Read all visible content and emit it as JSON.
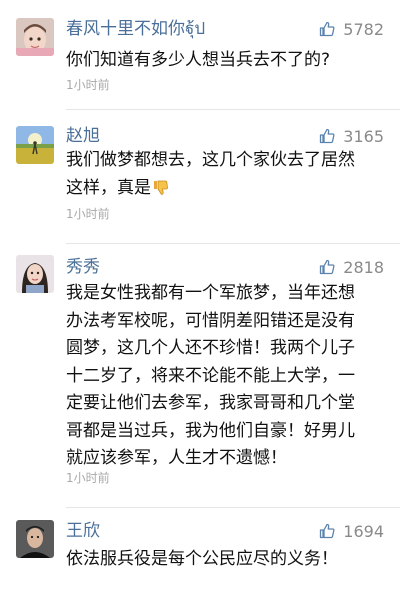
{
  "comments": [
    {
      "user": "春风十里不如你ฐุ้ป",
      "likes": "5782",
      "text_lines": [
        "你们知道有多少人想当兵去不了的?"
      ],
      "time": "1小时前"
    },
    {
      "user": "赵旭",
      "likes": "3165",
      "text_lines": [
        "我们做梦都想去，这几个家伙去了居然",
        "这样，真是"
      ],
      "emoji": "thumbs-down-emoji",
      "time": "1小时前"
    },
    {
      "user": "秀秀",
      "likes": "2818",
      "text_lines": [
        "我是女性我都有一个军旅梦，当年还想",
        "办法考军校呢，可惜阴差阳错还是没有",
        "圆梦，这几个人还不珍惜！我两个儿子",
        "十二岁了，将来不论能不能上大学，一",
        "定要让他们去参军，我家哥哥和几个堂",
        "哥都是当过兵，我为他们自豪！好男儿",
        "就应该参军，人生才不遗憾！"
      ],
      "time": "1小时前"
    },
    {
      "user": "王欣",
      "likes": "1694",
      "text_lines": [
        "依法服兵役是每个公民应尽的义务！"
      ]
    }
  ],
  "colors": {
    "username": "#4a6f98",
    "meta": "#8a8a8a",
    "time": "#a9a9a9"
  },
  "icons": {
    "like": "thumbs-up-icon"
  }
}
